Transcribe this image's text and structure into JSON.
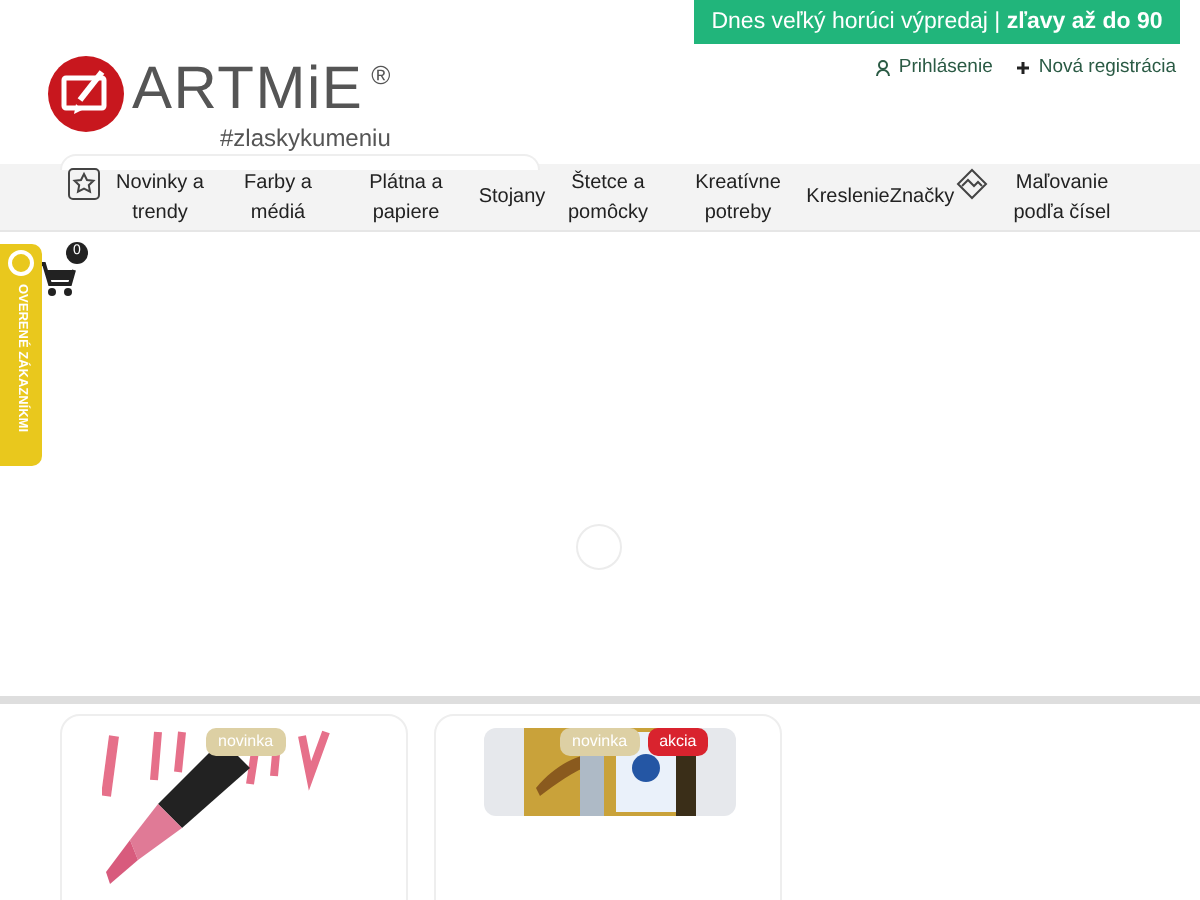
{
  "promo_banner": {
    "text": "Dnes veľký horúci výpredaj | **zľavy až do 90**"
  },
  "account_links": [
    "Prihlásenie",
    "Nová registrácia"
  ],
  "logo": {
    "name": "ARTMiE",
    "mark": "®",
    "tagline": "#zlaskykumeniu"
  },
  "nav": [
    {
      "label": "Novinky a trendy",
      "kind": "icon"
    },
    {
      "label": "Farby a médiá"
    },
    {
      "label": "Plátna a papiere"
    },
    {
      "label": "Stojany"
    },
    {
      "label": "Štetce a pomôcky"
    },
    {
      "label": "Kreatívne potreby"
    },
    {
      "label": "Kreslenie"
    },
    {
      "label": "Značky"
    },
    {
      "label": "Maľovanie podľa čísel",
      "kind": "icon"
    }
  ],
  "cart": {
    "count": "0"
  },
  "side_tab": {
    "label": "OVERENÉ ZÁKAZNÍKMI"
  },
  "products": [
    {
      "kind": "picture",
      "badges": [
        {
          "label": "novinka",
          "color": "#ddd0a4"
        }
      ]
    },
    {
      "kind": "picture",
      "badges": [
        {
          "label": "novinka",
          "color": "#ddd0a4"
        },
        {
          "label": "akcia",
          "color": "#d9232e"
        }
      ]
    }
  ]
}
